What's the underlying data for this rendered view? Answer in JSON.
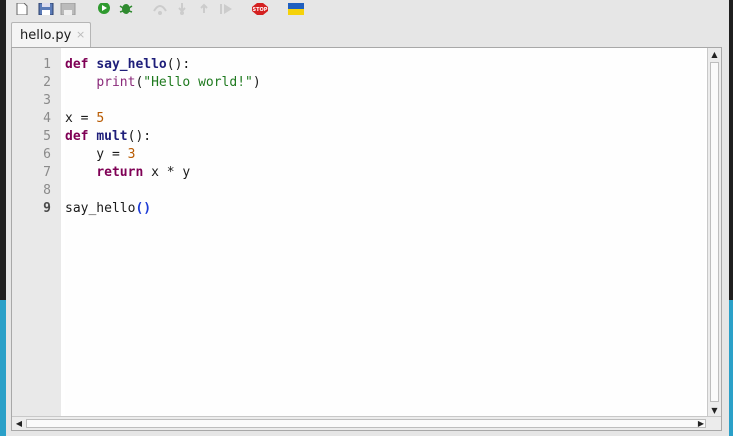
{
  "toolbar": {
    "buttons": [
      "new-file",
      "save",
      "save-all",
      "run",
      "debug",
      "step-over",
      "step-into",
      "step-out",
      "resume",
      "stop",
      "flag"
    ]
  },
  "tab": {
    "label": "hello.py",
    "close": "×"
  },
  "editor": {
    "line_numbers": [
      "1",
      "2",
      "3",
      "4",
      "5",
      "6",
      "7",
      "8",
      "9"
    ],
    "active_line": "9",
    "lines": [
      {
        "kw": "def",
        "sp": " ",
        "name": "say_hello",
        "rest": "():"
      },
      {
        "indent": "    ",
        "builtin": "print",
        "open": "(",
        "str": "\"Hello world!\"",
        "close": ")"
      },
      {
        "text": ""
      },
      {
        "pre": "x = ",
        "num": "5"
      },
      {
        "kw": "def",
        "sp": " ",
        "name": "mult",
        "rest": "():"
      },
      {
        "pre": "    y = ",
        "num": "3"
      },
      {
        "indent": "    ",
        "kw": "return",
        "rest": " x * y"
      },
      {
        "text": ""
      },
      {
        "pre": "say_hello",
        "brackets": "()"
      }
    ]
  },
  "colors": {
    "keyword": "#7f0055",
    "function": "#1e1e7a",
    "string": "#1f7a1f",
    "number": "#b85a00",
    "bracket": "#1d3bd6"
  }
}
